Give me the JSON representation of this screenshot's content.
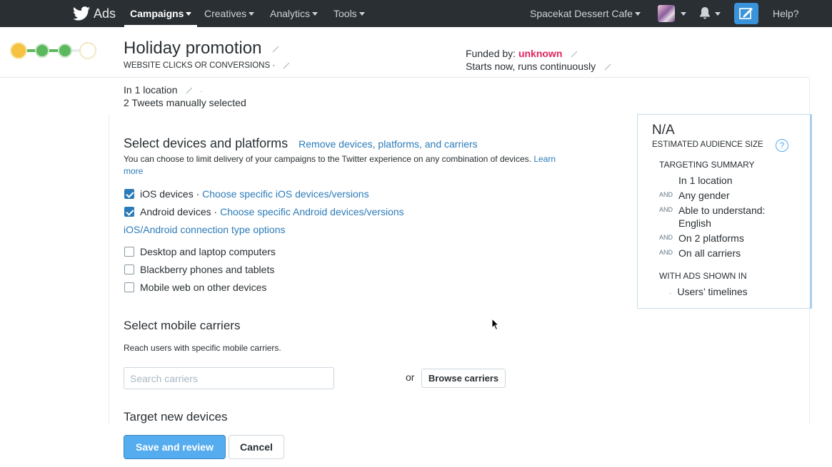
{
  "nav": {
    "brand": "Ads",
    "items": [
      {
        "label": "Campaigns",
        "active": true
      },
      {
        "label": "Creatives",
        "active": false
      },
      {
        "label": "Analytics",
        "active": false
      },
      {
        "label": "Tools",
        "active": false
      }
    ],
    "account": "Spacekat Dessert Cafe",
    "help": "Help?"
  },
  "campaign": {
    "title": "Holiday promotion",
    "objective": "WEBSITE CLICKS OR CONVERSIONS ·",
    "funded_label": "Funded by: ",
    "funded_value": "unknown",
    "schedule": "Starts now, runs continuously",
    "location": "In 1 location",
    "location_sep": "·",
    "tweets": "2 Tweets manually selected"
  },
  "devices": {
    "heading": "Select devices and platforms",
    "remove_link": "Remove devices, platforms, and carriers",
    "description": "You can choose to limit delivery of your campaigns to the Twitter experience on any combination of devices.",
    "learn_more": "Learn more",
    "options": [
      {
        "label": "iOS devices",
        "sep": " · ",
        "link": "Choose specific iOS devices/versions",
        "checked": true
      },
      {
        "label": "Android devices",
        "sep": " · ",
        "link": "Choose specific Android devices/versions",
        "checked": true
      }
    ],
    "connection_link": "iOS/Android connection type options",
    "other_options": [
      {
        "label": "Desktop and laptop computers",
        "checked": false
      },
      {
        "label": "Blackberry phones and tablets",
        "checked": false
      },
      {
        "label": "Mobile web on other devices",
        "checked": false
      }
    ]
  },
  "carriers": {
    "heading": "Select mobile carriers",
    "description": "Reach users with specific mobile carriers.",
    "search_placeholder": "Search carriers",
    "or_label": "or",
    "browse_button": "Browse carriers"
  },
  "new_devices": {
    "heading": "Target new devices"
  },
  "actions": {
    "save": "Save and review",
    "cancel": "Cancel"
  },
  "summary": {
    "audience_size": "N/A",
    "audience_label": "ESTIMATED AUDIENCE SIZE",
    "help_icon": "?",
    "targeting_heading": "TARGETING SUMMARY",
    "items": [
      {
        "prefix": "",
        "text": "In 1 location"
      },
      {
        "prefix": "AND",
        "text": "Any gender"
      },
      {
        "prefix": "AND",
        "text": "Able to understand: English"
      },
      {
        "prefix": "AND",
        "text": "On 2 platforms"
      },
      {
        "prefix": "AND",
        "text": "On all carriers"
      }
    ],
    "ads_heading": "WITH ADS SHOWN IN",
    "ads_bullet": "·",
    "ads_location": "Users’ timelines"
  },
  "colors": {
    "nav_bg": "#292f33",
    "link": "#2b7bb9",
    "accent": "#55acee",
    "funded_red": "#e0245e",
    "progress_complete": "#5cb85c",
    "progress_start": "#f5c242"
  },
  "icons": [
    "twitter-bird-icon",
    "caret-down-icon",
    "bell-icon",
    "compose-icon",
    "pencil-icon",
    "question-icon",
    "checkbox-icon",
    "mouse-cursor-icon"
  ]
}
